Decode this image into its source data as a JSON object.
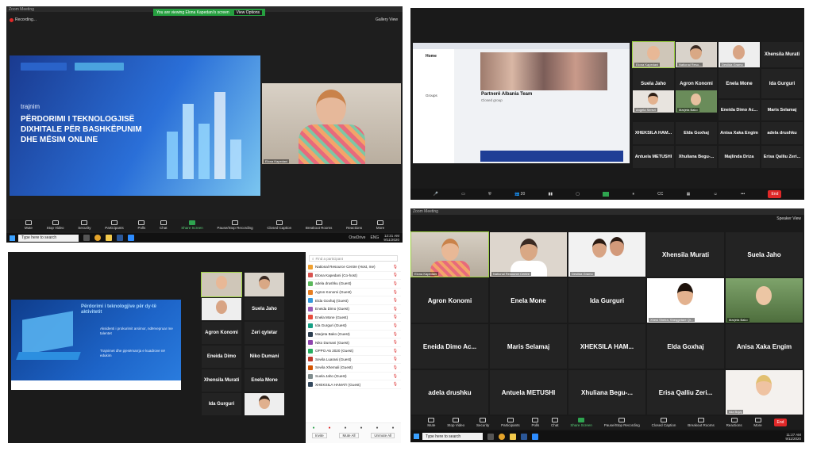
{
  "q1": {
    "window_title": "Zoom Meeting",
    "recording": "Recording...",
    "viewing_banner": "You are viewing Elona Kapedani's screen",
    "view_options": "View Options",
    "gallery_view": "Gallery View",
    "slide_title_small": "trajnim",
    "slide_heading": "PËRDORIMI I TEKNOLOGJISË DIXHITALE PËR BASHKËPUNIM DHE MËSIM ONLINE",
    "speaker_name": "Elona Kapedani",
    "toolbar": [
      "Mute",
      "Stop Video",
      "Security",
      "Participants",
      "Polls",
      "Chat",
      "Share Screen",
      "Pause/Stop Recording",
      "Closed Caption",
      "Breakout Rooms",
      "Reactions",
      "More"
    ],
    "participants_count": "17",
    "taskbar_search": "Type here to search",
    "taskbar_time": "12:21 AM",
    "taskbar_date": "9/11/2020",
    "taskbar_lang": "ENG",
    "onedrive": "OneDrive"
  },
  "q2": {
    "team_title": "Partnerë Albania Team",
    "team_sub": "Closed group",
    "home_label": "Home",
    "groups_label": "Groups",
    "end": "End",
    "participants_count": "20",
    "video_tiles": [
      {
        "label": "Elona Kapedani"
      },
      {
        "label": "National Reso..."
      },
      {
        "label": "Desilda Gramo"
      }
    ],
    "name_tiles_top": [
      "Xhensila Murati"
    ],
    "row2": [
      "Suela Jaho",
      "Agron Konomi",
      "Enela Mone",
      "Ida Gurguri"
    ],
    "row3_video": [
      {
        "label": "Angela Serezi"
      },
      {
        "label": "Marjeta Bako"
      }
    ],
    "row3": [
      "Eneida Dimo Ac...",
      "Maris Selamaj"
    ],
    "row4": [
      "XHEKSILA HAM...",
      "Elda Goxhaj",
      "Anisa Xaka Engim",
      "adela drushku"
    ],
    "row5": [
      "Antuela METUSHI",
      "Xhuliana Begu-...",
      "Majlinda Driza",
      "Erisa Qalliu Zeri..."
    ]
  },
  "q3": {
    "slide_title": "Përdorimi i teknologjive për dy-të aktivitetit",
    "bullet1": "Aksidenti i prokurimit arsimor, ndërvepruar me talentet",
    "bullet2": "Trajnimet dhe pjesëmarrja e kuadrove në edukim",
    "participant_search": "Find a participant",
    "participants": [
      {
        "name": "National Resource Centre (Host, me)",
        "color": "#f0a030"
      },
      {
        "name": "Elona Kapedani (Co-host)",
        "color": "#d9534f"
      },
      {
        "name": "adela drushku (Guest)",
        "color": "#5cb85c"
      },
      {
        "name": "Agron Konomi (Guest)",
        "color": "#e67e22"
      },
      {
        "name": "Elda Goxhaj (Guest)",
        "color": "#3498db"
      },
      {
        "name": "Eneida Dimo (Guest)",
        "color": "#9b59b6"
      },
      {
        "name": "Enela Mone (Guest)",
        "color": "#e74c3c"
      },
      {
        "name": "Ida Gurguri (Guest)",
        "color": "#16a085"
      },
      {
        "name": "Marjeta Bako (Guest)",
        "color": "#2c3e50"
      },
      {
        "name": "Niko Dumani (Guest)",
        "color": "#8e44ad"
      },
      {
        "name": "OPPO A5 2020 (Guest)",
        "color": "#27ae60"
      },
      {
        "name": "Sevila Luarasi (Guest)",
        "color": "#c0392b"
      },
      {
        "name": "Sevila Xhemali (Guest)",
        "color": "#d35400"
      },
      {
        "name": "Suela Jaho (Guest)",
        "color": "#7f8c8d"
      },
      {
        "name": "XHEKSILA HAMATI (Guest)",
        "color": "#34495e"
      }
    ],
    "bottom_buttons": [
      "Invite",
      "Mute All",
      "Unmute All"
    ],
    "name_tiles": [
      "Suela Jaho",
      "Agron Konomi",
      "Zeri qytetar",
      "Eneida Dimo",
      "Niko Dumani",
      "Xhensila Murati",
      "Enela Mone",
      "Ida Gurguri"
    ]
  },
  "q4": {
    "window_title": "Zoom Meeting",
    "speaker_view": "Speaker View",
    "video_tiles": [
      {
        "label": "Elona Kapedani"
      },
      {
        "label": "National Resource Centre"
      },
      {
        "label": "Desilda Gramo"
      }
    ],
    "row1": [
      "Xhensila Murati",
      "Suela Jaho"
    ],
    "row2": [
      "Agron Konomi",
      "Enela Mone",
      "Ida Gurguri"
    ],
    "row2_video": [
      {
        "label": "Xhesi Sheira, Sheqgetare Qr..."
      },
      {
        "label": "Marjeta Bako"
      }
    ],
    "row3": [
      "Eneida Dimo Ac...",
      "Maris Selamaj",
      "XHEKSILA HAM...",
      "Elda Goxhaj",
      "Anisa Xaka Engim"
    ],
    "row4": [
      "adela drushku",
      "Antuela METUSHI",
      "Xhuliana Begu-...",
      "Erisa Qalliu Zeri..."
    ],
    "row4_video": [
      {
        "label": "Ilda Bojaj"
      }
    ],
    "toolbar": [
      "Mute",
      "Stop Video",
      "Security",
      "Participants",
      "Polls",
      "Chat",
      "Share Screen",
      "Pause/Stop Recording",
      "Closed Caption",
      "Breakout Rooms",
      "Reactions",
      "More"
    ],
    "participants_count": "20",
    "taskbar_search": "Type here to search",
    "taskbar_time": "11:27 AM",
    "taskbar_date": "9/11/2020",
    "end": "End"
  }
}
